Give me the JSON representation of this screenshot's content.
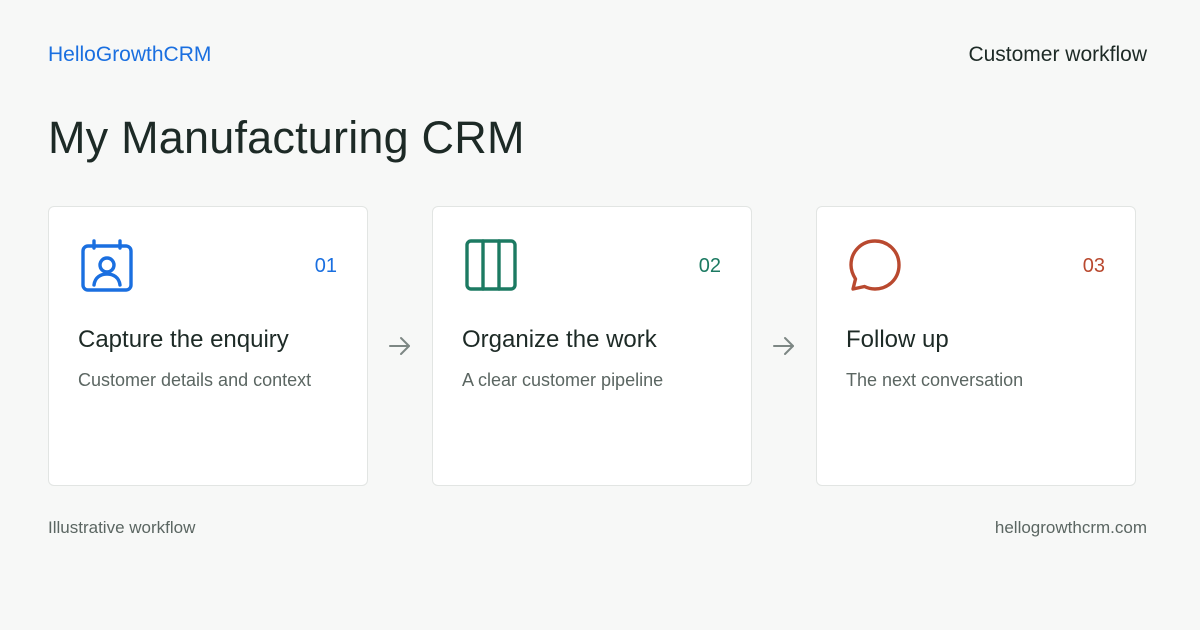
{
  "header": {
    "brand": "HelloGrowthCRM",
    "section": "Customer workflow"
  },
  "title": "My Manufacturing CRM",
  "steps": [
    {
      "number": "01",
      "heading": "Capture the enquiry",
      "description": "Customer details and context",
      "icon": "contact-card-icon",
      "color": "#1a6fe0"
    },
    {
      "number": "02",
      "heading": "Organize the work",
      "description": "A clear customer pipeline",
      "icon": "columns-board-icon",
      "color": "#1c7a62"
    },
    {
      "number": "03",
      "heading": "Follow up",
      "description": "The next conversation",
      "icon": "chat-bubble-icon",
      "color": "#b9492f"
    }
  ],
  "footer": {
    "left": "Illustrative workflow",
    "right": "hellogrowthcrm.com"
  }
}
